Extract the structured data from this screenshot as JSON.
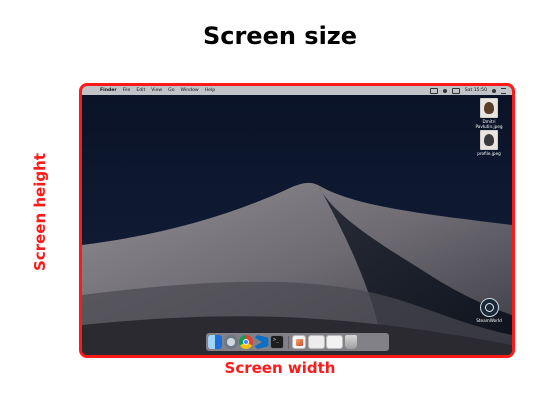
{
  "title": "Screen size",
  "labels": {
    "height": "Screen height",
    "width": "Screen width"
  },
  "menubar": {
    "items": [
      "Finder",
      "File",
      "Edit",
      "View",
      "Go",
      "Window",
      "Help"
    ],
    "clock": "Sat 15:50"
  },
  "desktop": {
    "files": [
      {
        "name": "Dmitri Pavlutin.jpeg",
        "icon": "jpeg-file-icon"
      },
      {
        "name": "profile.jpeg",
        "icon": "jpeg-file-icon"
      },
      {
        "name": "SteamWorld",
        "icon": "steam-icon"
      }
    ]
  },
  "dock": {
    "apps": [
      "finder-icon",
      "launchpad-icon",
      "chrome-icon",
      "vscode-icon",
      "terminal-icon",
      "preview-icon",
      "window-thumbnail-icon",
      "window-thumbnail-icon",
      "trash-icon"
    ]
  },
  "colors": {
    "accent": "#ff1a1a",
    "wallpaper_sky": "#0b1225"
  }
}
